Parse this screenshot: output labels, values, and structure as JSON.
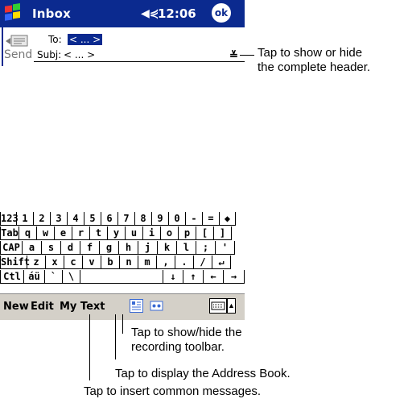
{
  "titlebar": {
    "title": "Inbox",
    "time": "12:06",
    "ok": "ok",
    "volume_glyph": "◀⋞"
  },
  "header": {
    "send_label": "Send",
    "to_label": "To:",
    "to_value": "< ... >",
    "subj_label": "Subj:",
    "subj_value": "< ... >",
    "expand_glyph": "≚"
  },
  "keyboard": {
    "rows": [
      [
        "123",
        "1",
        "2",
        "3",
        "4",
        "5",
        "6",
        "7",
        "8",
        "9",
        "0",
        "-",
        "=",
        "◆"
      ],
      [
        "Tab",
        "q",
        "w",
        "e",
        "r",
        "t",
        "y",
        "u",
        "i",
        "o",
        "p",
        "[",
        "]"
      ],
      [
        "CAP",
        "a",
        "s",
        "d",
        "f",
        "g",
        "h",
        "j",
        "k",
        "l",
        ";",
        "'"
      ],
      [
        "Shift",
        "z",
        "x",
        "c",
        "v",
        "b",
        "n",
        "m",
        ",",
        ".",
        "/",
        "↵"
      ],
      [
        "Ctl",
        "áü",
        "`",
        "\\",
        "",
        "↓",
        "↑",
        "←",
        "→"
      ]
    ]
  },
  "command_bar": {
    "menus": [
      "New",
      "Edit",
      "My Text"
    ],
    "address_book_icon": "address-book-icon",
    "recording_icon": "recording-icon",
    "keyboard_icon": "keyboard-icon",
    "arrow": "▲"
  },
  "callouts": {
    "header": "Tap to show or hide\nthe complete header.",
    "recording": "Tap to show/hide the\nrecording toolbar.",
    "address_book": "Tap to display the Address Book.",
    "my_text": "Tap to insert common messages."
  },
  "colors": {
    "titlebar": "#0b2a8f",
    "cmdbar": "#d4d0c8",
    "highlight": "#3a6ad4"
  }
}
